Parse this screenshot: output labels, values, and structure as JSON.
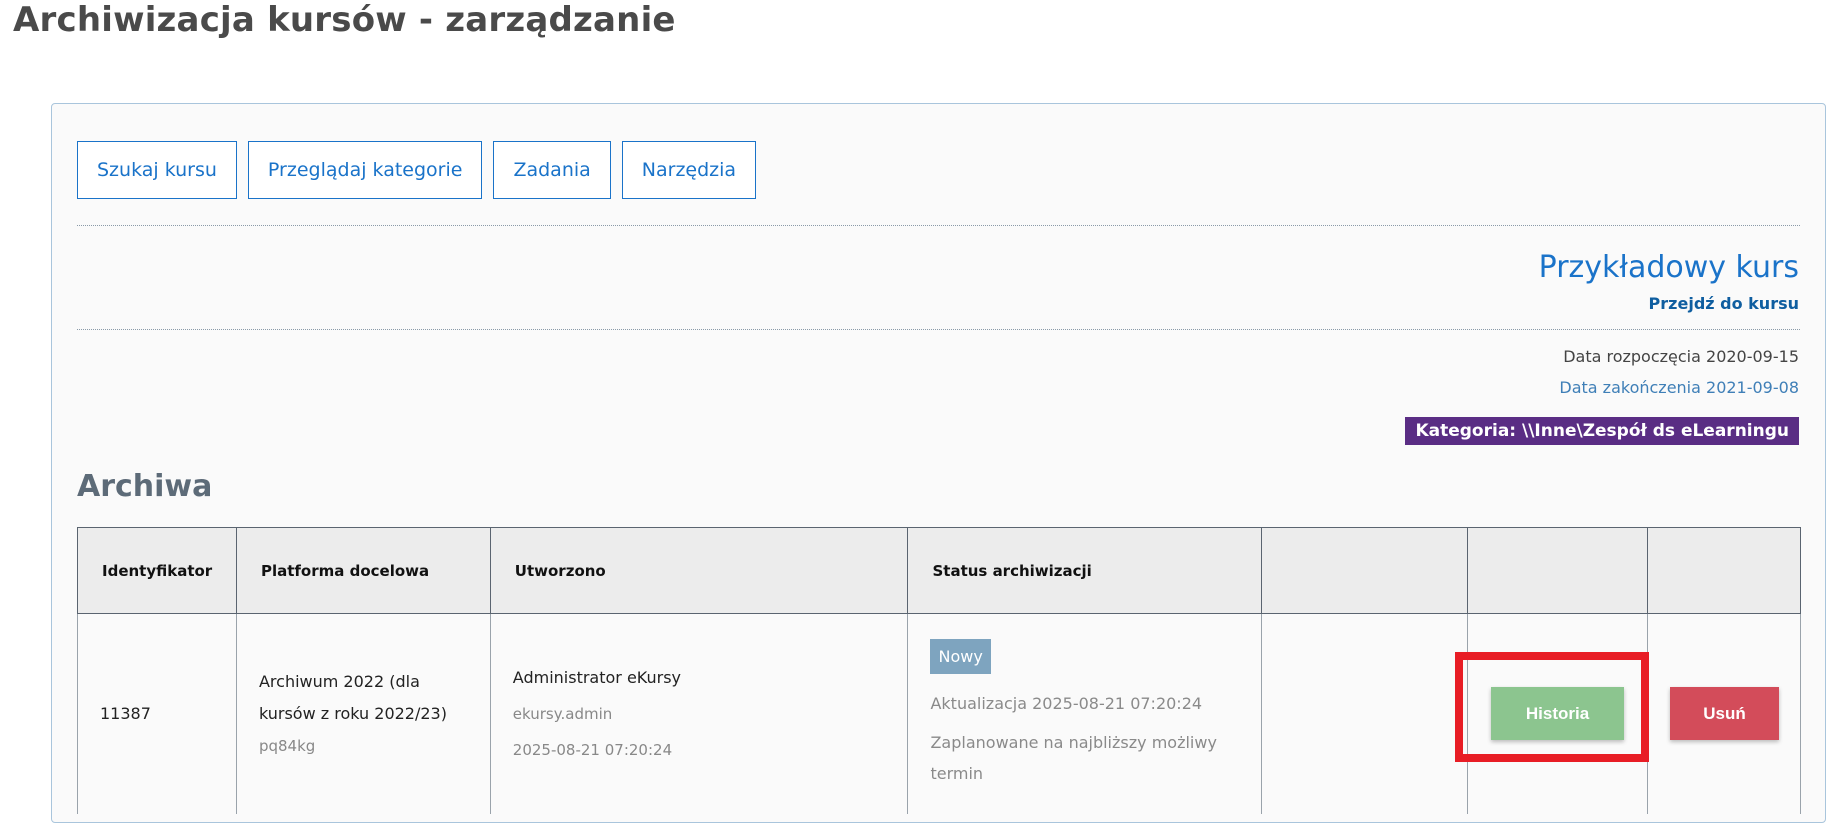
{
  "page": {
    "title": "Archiwizacja kursów - zarządzanie"
  },
  "tabs": [
    {
      "label": "Szukaj kursu"
    },
    {
      "label": "Przeglądaj kategorie"
    },
    {
      "label": "Zadania"
    },
    {
      "label": "Narzędzia"
    }
  ],
  "course": {
    "name": "Przykładowy kurs",
    "goto_label": "Przejdź do kursu",
    "start_date": "Data rozpoczęcia 2020-09-15",
    "end_date": "Data zakończenia 2021-09-08",
    "category": "Kategoria: \\\\Inne\\Zespół ds eLearningu"
  },
  "archives": {
    "title": "Archiwa",
    "columns": [
      "Identyfikator",
      "Platforma docelowa",
      "Utworzono",
      "Status archiwizacji",
      "",
      "",
      ""
    ],
    "rows": [
      {
        "id": "11387",
        "platform_line1": "Archiwum 2022 (dla",
        "platform_line2": "kursów z roku 2022/23)",
        "platform_code": "pq84kg",
        "created_by": "Administrator eKursy",
        "created_login": "ekursy.admin",
        "created_at": "2025-08-21 07:20:24",
        "status_badge": "Nowy",
        "status_updated": "Aktualizacja 2025-08-21 07:20:24",
        "status_planned_line1": "Zaplanowane na najbliższy możliwy",
        "status_planned_line2": "termin",
        "history_label": "Historia",
        "delete_label": "Usuń"
      }
    ]
  },
  "colors": {
    "accent": "#1a73c9",
    "category_bg": "#5a2d84",
    "history_button": "#8cc58f",
    "delete_button": "#d34c5a",
    "badge_new": "#7ea4bf",
    "highlight": "#e81d25"
  }
}
